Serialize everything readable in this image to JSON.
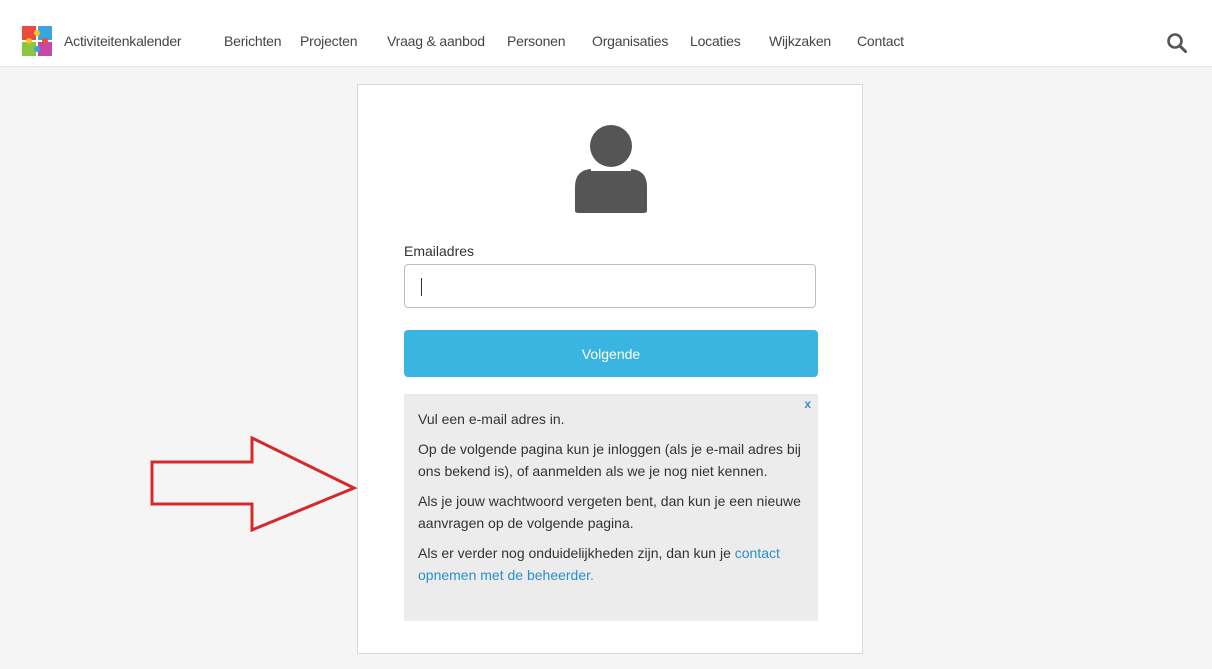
{
  "nav": {
    "items": [
      "Activiteitenkalender",
      "Berichten",
      "Projecten",
      "Vraag & aanbod",
      "Personen",
      "Organisaties",
      "Locaties",
      "Wijkzaken",
      "Contact"
    ],
    "search_icon": "search-icon",
    "logo_icon": "puzzle-logo-icon"
  },
  "form": {
    "avatar_icon": "user-avatar-icon",
    "email_label": "Emailadres",
    "email_value": "",
    "email_placeholder": "",
    "next_label": "Volgende"
  },
  "info": {
    "close_label": "x",
    "line1": "Vul een e-mail adres in.",
    "line2": "Op de volgende pagina kun je inloggen (als je e-mail adres bij ons bekend is), of aanmelden als we je nog niet kennen.",
    "line3": "Als je jouw wachtwoord vergeten bent, dan kun je een nieuwe aanvragen op de volgende pagina.",
    "line4_text": "Als er verder nog onduidelijkheden zijn, dan kun je ",
    "line4_link": "contact opnemen met de beheerder."
  },
  "annotation": {
    "arrow_icon": "red-arrow-icon",
    "arrow_color": "#d62a2a"
  },
  "colors": {
    "accent": "#3ab4e0",
    "link": "#2a8fc8",
    "info_bg": "#ececec"
  }
}
